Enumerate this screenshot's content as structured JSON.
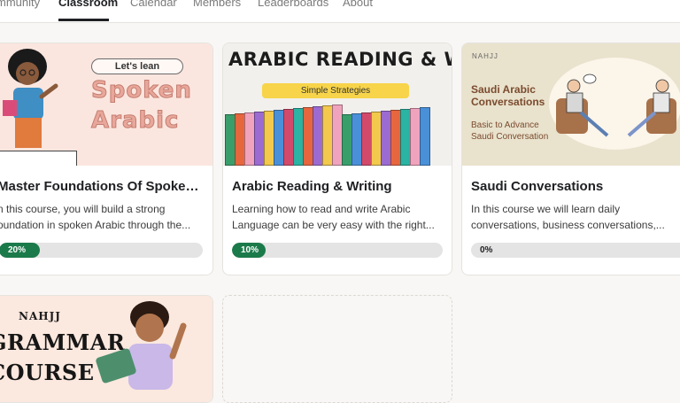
{
  "nav": {
    "tabs": [
      {
        "label": "mmunity"
      },
      {
        "label": "Classroom"
      },
      {
        "label": "Calendar"
      },
      {
        "label": "Members"
      },
      {
        "label": "Leaderboards"
      },
      {
        "label": "About"
      }
    ],
    "active_tab": "Classroom"
  },
  "courses": [
    {
      "title": "Master Foundations Of Spoken Ar...",
      "desc": "n this course, you will build a strong oundation in spoken Arabic through the...",
      "progress_percent": 20,
      "progress_label": "20%",
      "thumb": {
        "pill": "Let's lean",
        "big1": "Spoken",
        "big2": "Arabic"
      }
    },
    {
      "title": "Arabic Reading & Writing",
      "desc": "Learning how to read and write Arabic Language can be very easy with the right...",
      "progress_percent": 10,
      "progress_label": "10%",
      "thumb": {
        "heading": "ARABIC READING & WRITING",
        "strip": "Simple Strategies"
      }
    },
    {
      "title": "Saudi Conversations",
      "desc": "In this course we will learn daily conversations, business conversations,...",
      "progress_percent": 0,
      "progress_label": "0%",
      "thumb": {
        "brand": "NAHJJ",
        "heading": "Saudi Arabic Conversations",
        "sub": "Basic to Advance Saudi Conversation"
      }
    },
    {
      "thumb": {
        "brand": "NAHJJ",
        "big1": "GRAMMAR",
        "big2": "COURSE"
      }
    }
  ],
  "colors": {
    "progress_fill": "#1b7a4a",
    "progress_track": "#e4e4e4",
    "background": "#f8f7f5"
  }
}
